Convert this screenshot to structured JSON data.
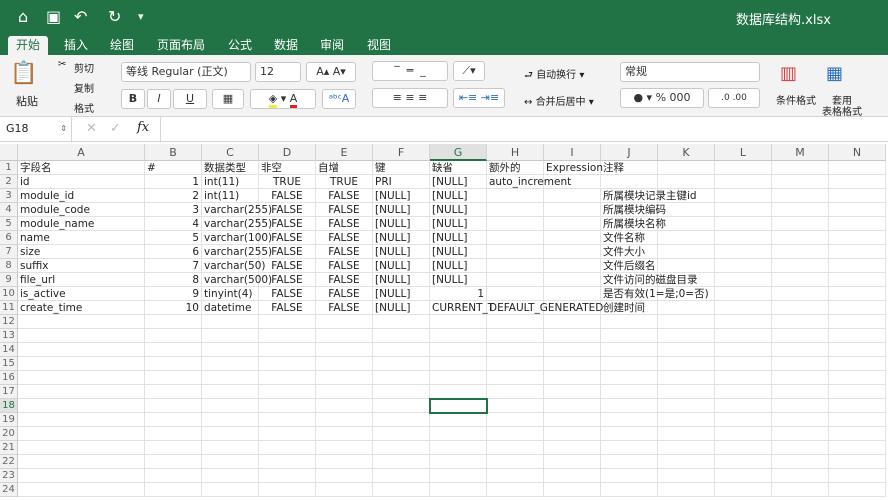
{
  "title_bar": {
    "document_title": "数据库结构.xlsx"
  },
  "tabs": [
    "开始",
    "插入",
    "绘图",
    "页面布局",
    "公式",
    "数据",
    "审阅",
    "视图"
  ],
  "active_tab": "开始",
  "ribbon": {
    "paste": "粘贴",
    "cut": "剪切",
    "copy": "复制",
    "format_painter": "格式",
    "font_name": "等线 Regular (正文)",
    "font_size": "12",
    "wrap_text": "自动换行",
    "merge_center": "合并后居中",
    "number_format": "常规",
    "percent": "%",
    "thousands": "000",
    "conditional_format": "条件格式",
    "table_format_1": "套用",
    "table_format_2": "表格格式",
    "bold": "B",
    "italic": "I",
    "underline": "U"
  },
  "formula_bar": {
    "name_box": "G18",
    "fx": "fx",
    "formula": ""
  },
  "accent_color": "#217346",
  "columns": [
    "A",
    "B",
    "C",
    "D",
    "E",
    "F",
    "G",
    "H",
    "I",
    "J",
    "K",
    "L",
    "M",
    "N"
  ],
  "selected_cell": "G18",
  "rows": [
    [
      "字段名",
      "#",
      "数据类型",
      "非空",
      "自增",
      "键",
      "缺省",
      "额外的",
      "Expression",
      "注释"
    ],
    [
      "id",
      "1",
      "int(11)",
      "TRUE",
      "TRUE",
      "PRI",
      "[NULL]",
      "auto_increment",
      "",
      ""
    ],
    [
      "module_id",
      "2",
      "int(11)",
      "FALSE",
      "FALSE",
      "[NULL]",
      "[NULL]",
      "",
      "",
      "所属模块记录主键id"
    ],
    [
      "module_code",
      "3",
      "varchar(255)",
      "FALSE",
      "FALSE",
      "[NULL]",
      "[NULL]",
      "",
      "",
      "所属模块编码"
    ],
    [
      "module_name",
      "4",
      "varchar(255)",
      "FALSE",
      "FALSE",
      "[NULL]",
      "[NULL]",
      "",
      "",
      "所属模块名称"
    ],
    [
      "name",
      "5",
      "varchar(100)",
      "FALSE",
      "FALSE",
      "[NULL]",
      "[NULL]",
      "",
      "",
      "文件名称"
    ],
    [
      "size",
      "6",
      "varchar(255)",
      "FALSE",
      "FALSE",
      "[NULL]",
      "[NULL]",
      "",
      "",
      "文件大小"
    ],
    [
      "suffix",
      "7",
      "varchar(50)",
      "FALSE",
      "FALSE",
      "[NULL]",
      "[NULL]",
      "",
      "",
      "文件后缀名"
    ],
    [
      "file_url",
      "8",
      "varchar(500)",
      "FALSE",
      "FALSE",
      "[NULL]",
      "[NULL]",
      "",
      "",
      "文件访问的磁盘目录"
    ],
    [
      "is_active",
      "9",
      "tinyint(4)",
      "FALSE",
      "FALSE",
      "[NULL]",
      "1",
      "",
      "",
      "是否有效(1=是;0=否)"
    ],
    [
      "create_time",
      "10",
      "datetime",
      "FALSE",
      "FALSE",
      "[NULL]",
      "CURRENT_T",
      "DEFAULT_GENERATED",
      "",
      "创建时间"
    ]
  ],
  "row_count": 24
}
